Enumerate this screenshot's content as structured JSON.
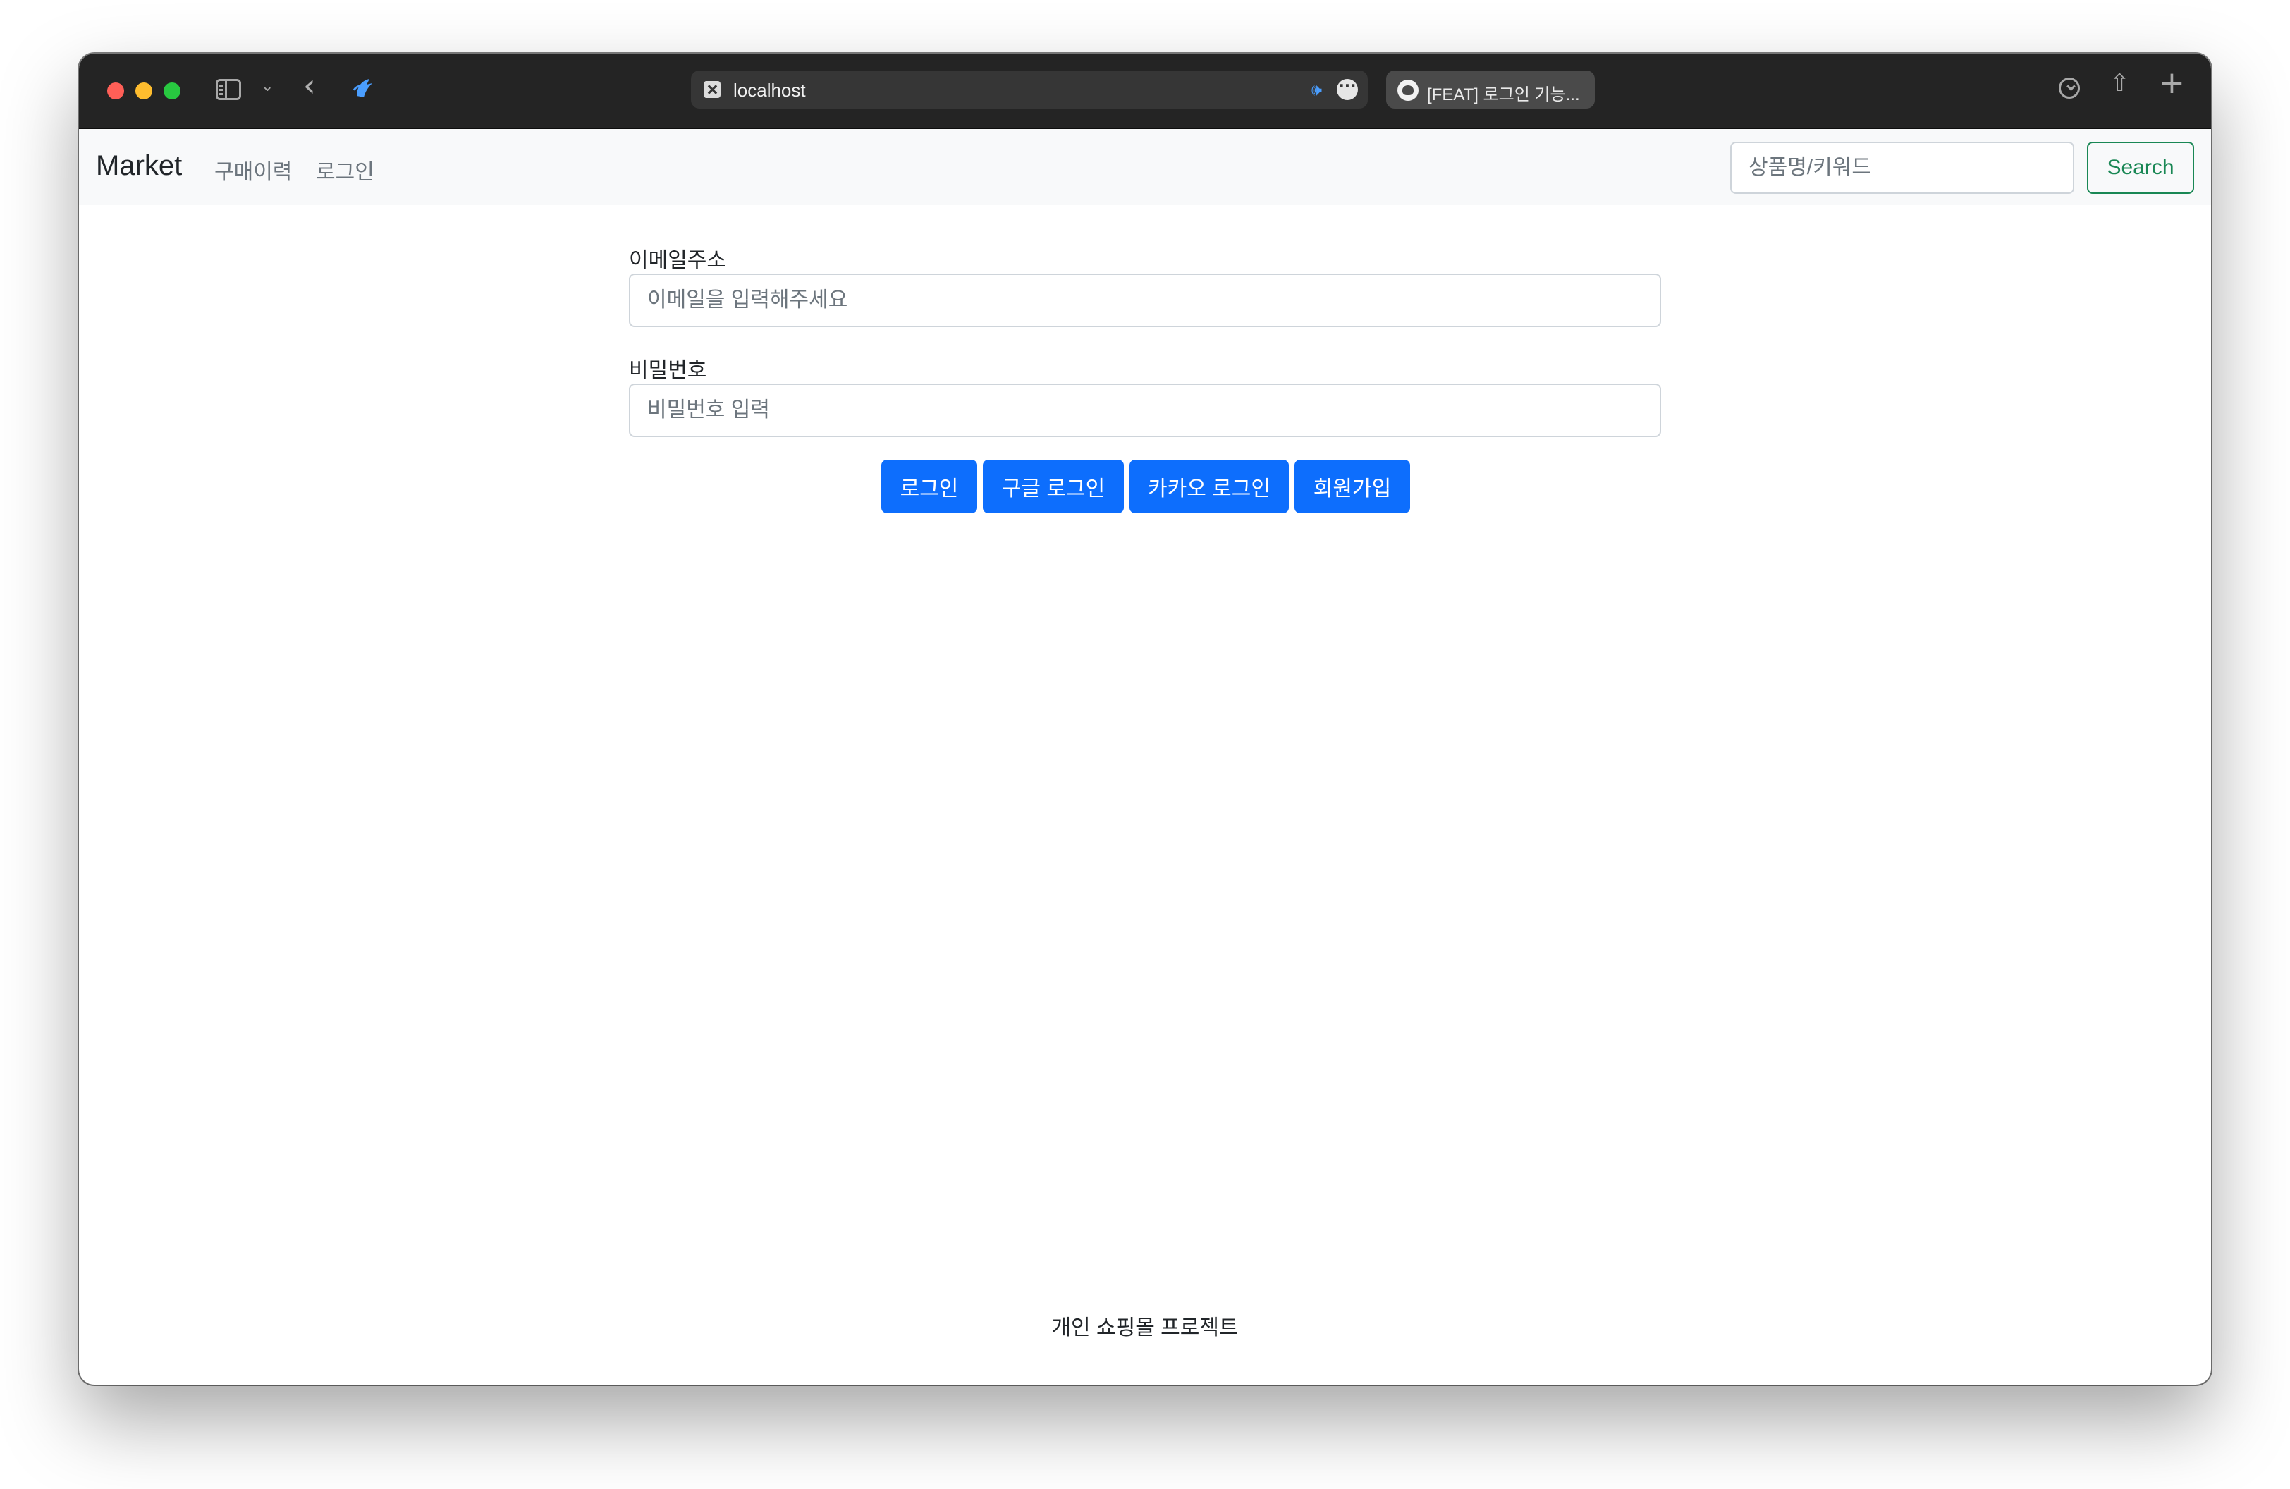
{
  "browser": {
    "url": "localhost",
    "second_tab_title": "[FEAT] 로그인 기능..."
  },
  "navbar": {
    "brand": "Market",
    "links": [
      "구매이력",
      "로그인"
    ],
    "search_placeholder": "상품명/키워드",
    "search_button": "Search"
  },
  "form": {
    "email_label": "이메일주소",
    "email_placeholder": "이메일을 입력해주세요",
    "password_label": "비밀번호",
    "password_placeholder": "비밀번호 입력",
    "buttons": [
      "로그인",
      "구글 로그인",
      "카카오 로그인",
      "회원가입"
    ]
  },
  "footer": {
    "text": "개인 쇼핑몰 프로젝트"
  },
  "colors": {
    "primary": "#0d6efd",
    "success": "#198754",
    "chrome": "#242424",
    "navbar_bg": "#f8f9fa"
  },
  "icons": [
    "sidebar-icon",
    "chevron-down-icon",
    "back-icon",
    "extension-icon",
    "site-favicon-icon",
    "audio-icon",
    "more-icon",
    "github-icon",
    "download-icon",
    "share-icon",
    "new-tab-icon"
  ]
}
